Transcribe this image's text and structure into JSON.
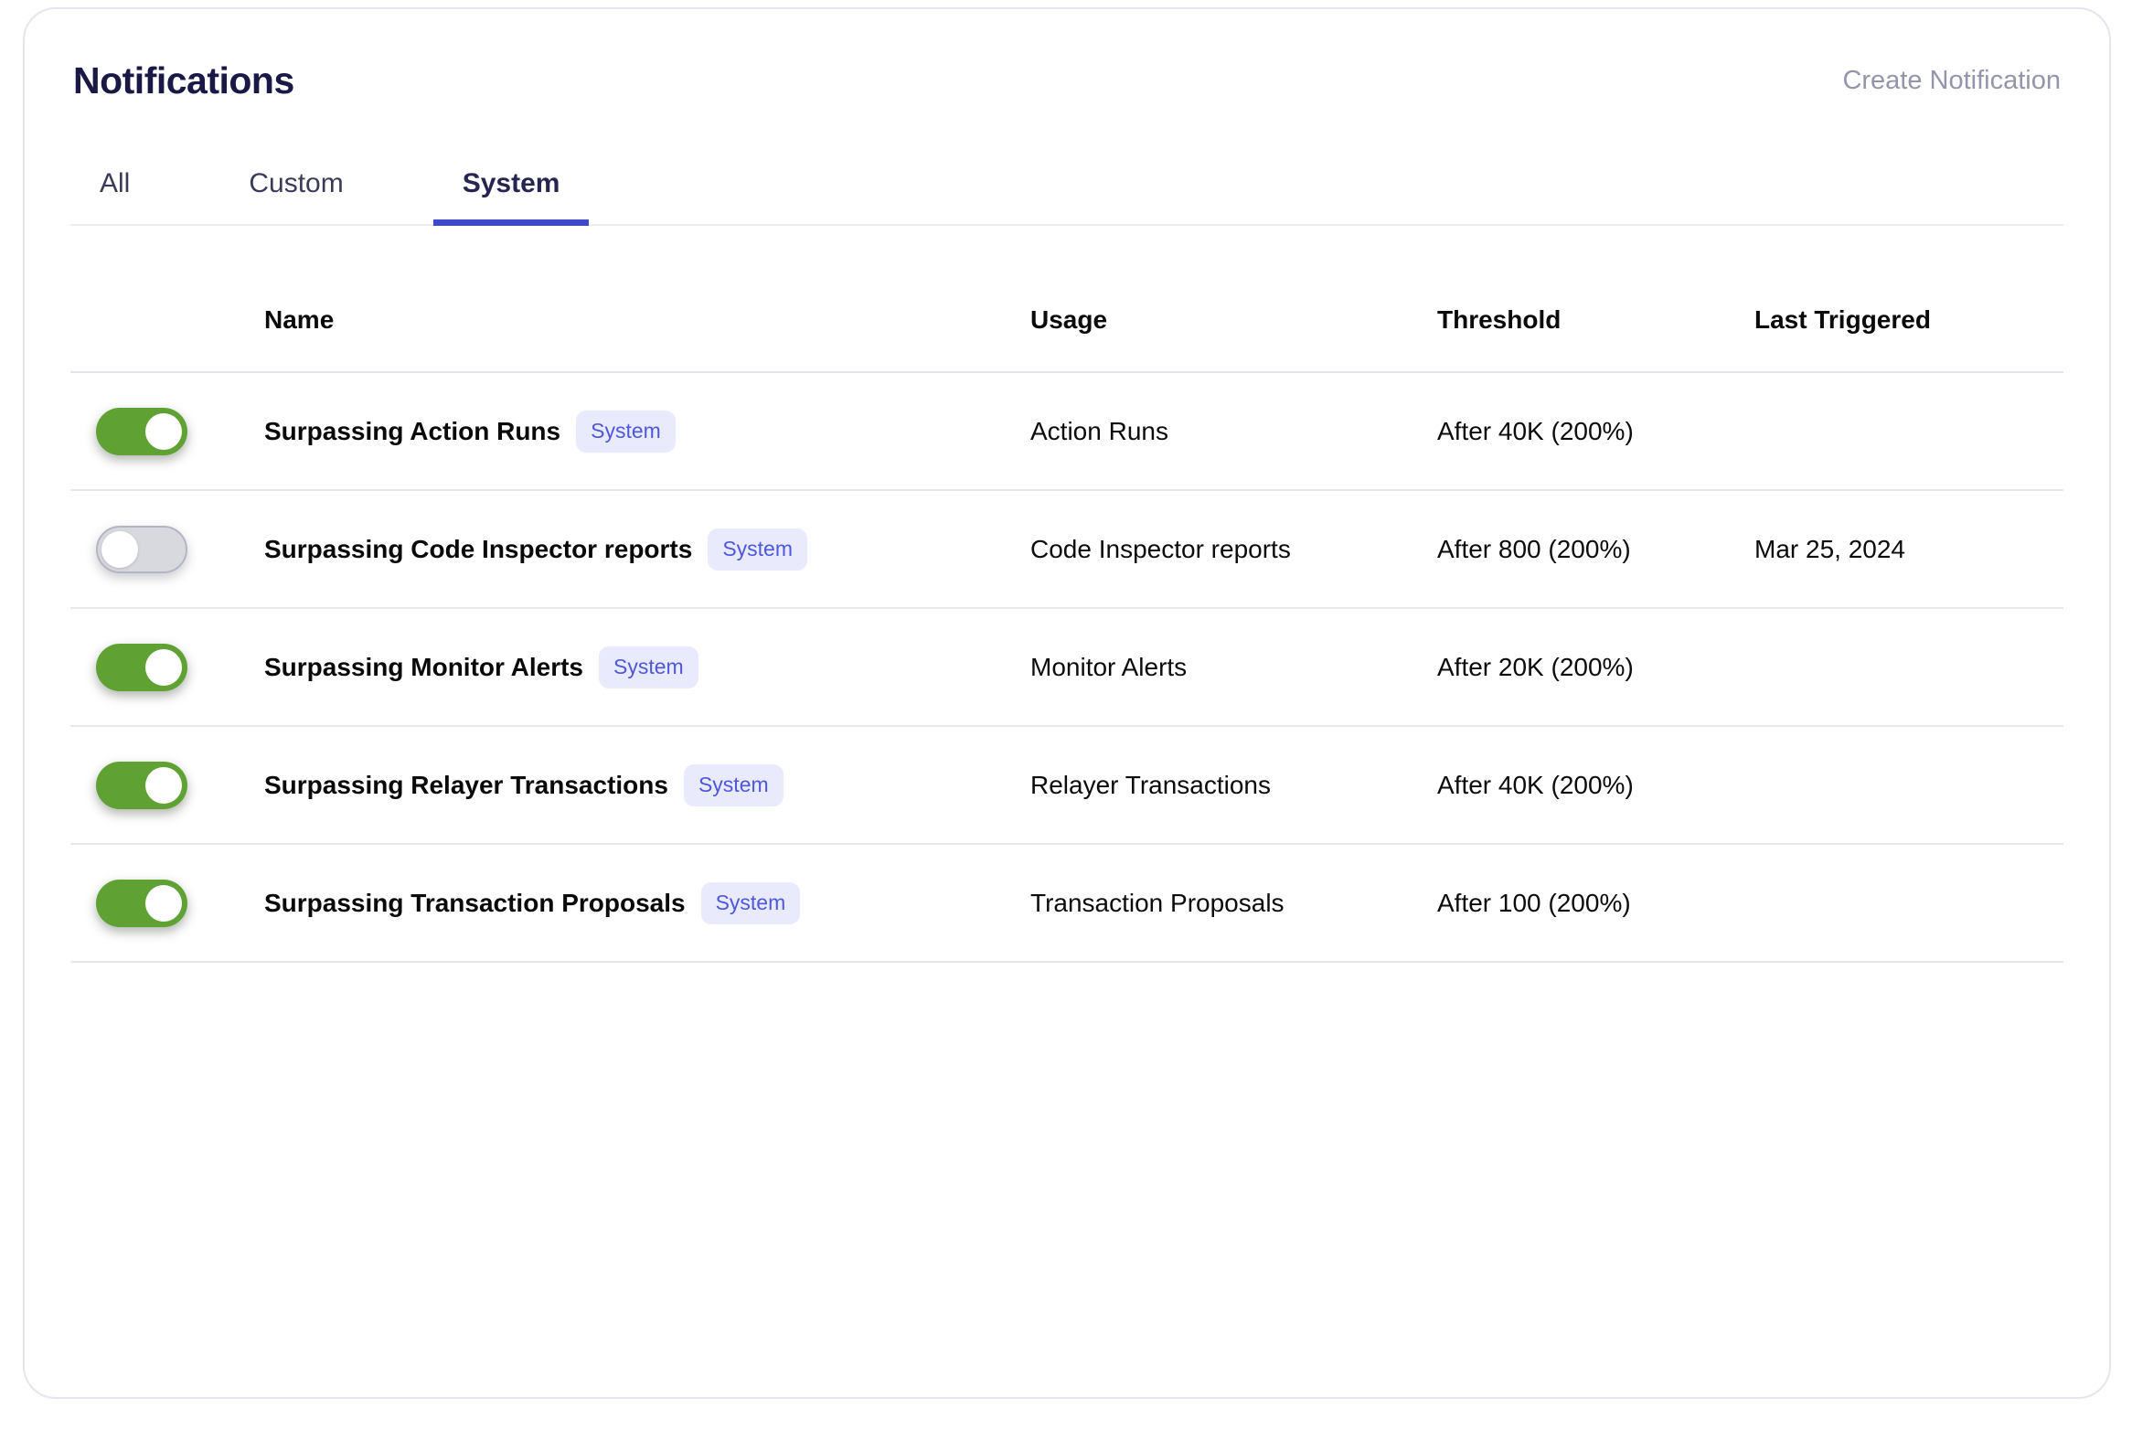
{
  "header": {
    "title": "Notifications",
    "create_button": "Create Notification"
  },
  "tabs": [
    {
      "label": "All",
      "active": false
    },
    {
      "label": "Custom",
      "active": false
    },
    {
      "label": "System",
      "active": true
    }
  ],
  "table": {
    "columns": [
      "Name",
      "Usage",
      "Threshold",
      "Last Triggered"
    ],
    "rows": [
      {
        "enabled": true,
        "name": "Surpassing Action Runs",
        "badge": "System",
        "usage": "Action Runs",
        "threshold": "After 40K (200%)",
        "last_triggered": ""
      },
      {
        "enabled": false,
        "name": "Surpassing Code Inspector reports",
        "badge": "System",
        "usage": "Code Inspector reports",
        "threshold": "After 800 (200%)",
        "last_triggered": "Mar 25, 2024"
      },
      {
        "enabled": true,
        "name": "Surpassing Monitor Alerts",
        "badge": "System",
        "usage": "Monitor Alerts",
        "threshold": "After 20K (200%)",
        "last_triggered": ""
      },
      {
        "enabled": true,
        "name": "Surpassing Relayer Transactions",
        "badge": "System",
        "usage": "Relayer Transactions",
        "threshold": "After 40K (200%)",
        "last_triggered": ""
      },
      {
        "enabled": true,
        "name": "Surpassing Transaction Proposals",
        "badge": "System",
        "usage": "Transaction Proposals",
        "threshold": "After 100 (200%)",
        "last_triggered": ""
      }
    ]
  },
  "colors": {
    "accent_indigo": "#4049CB",
    "title_navy": "#1A1945",
    "toggle_on_green": "#5FA233",
    "toggle_off_gray": "#D8D9DF",
    "badge_bg": "#E9EAFB",
    "badge_text": "#4F57DD",
    "create_gray": "#9495AB"
  }
}
